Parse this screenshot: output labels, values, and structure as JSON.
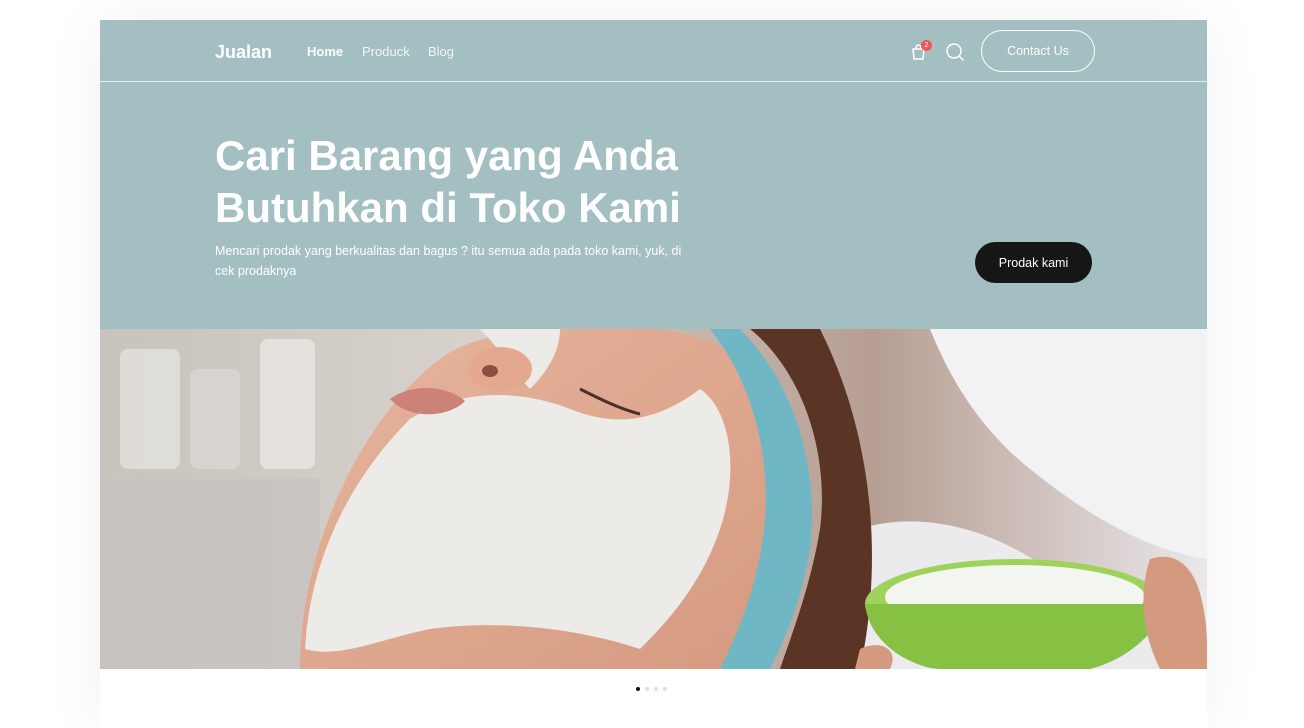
{
  "header": {
    "logo": "Jualan",
    "nav": [
      {
        "label": "Home",
        "active": true
      },
      {
        "label": "Produck",
        "active": false
      },
      {
        "label": "Blog",
        "active": false
      }
    ],
    "cart_count": "2",
    "contact_label": "Contact Us"
  },
  "hero": {
    "title_line1": "Cari Barang yang Anda",
    "title_line2": "Butuhkan di Toko Kami",
    "subtitle_line1": "Mencari prodak yang berkualitas dan bagus ? itu semua ada pada toko kami, yuk, di",
    "subtitle_line2": "cek prodaknya",
    "cta_label": "Prodak kami"
  },
  "carousel": {
    "slide_count": 4,
    "active_index": 0
  },
  "colors": {
    "hero_bg": "#a3bfc1",
    "cta_bg": "#161616",
    "badge": "#f0555b"
  },
  "icons": [
    "cart-icon",
    "search-icon"
  ]
}
